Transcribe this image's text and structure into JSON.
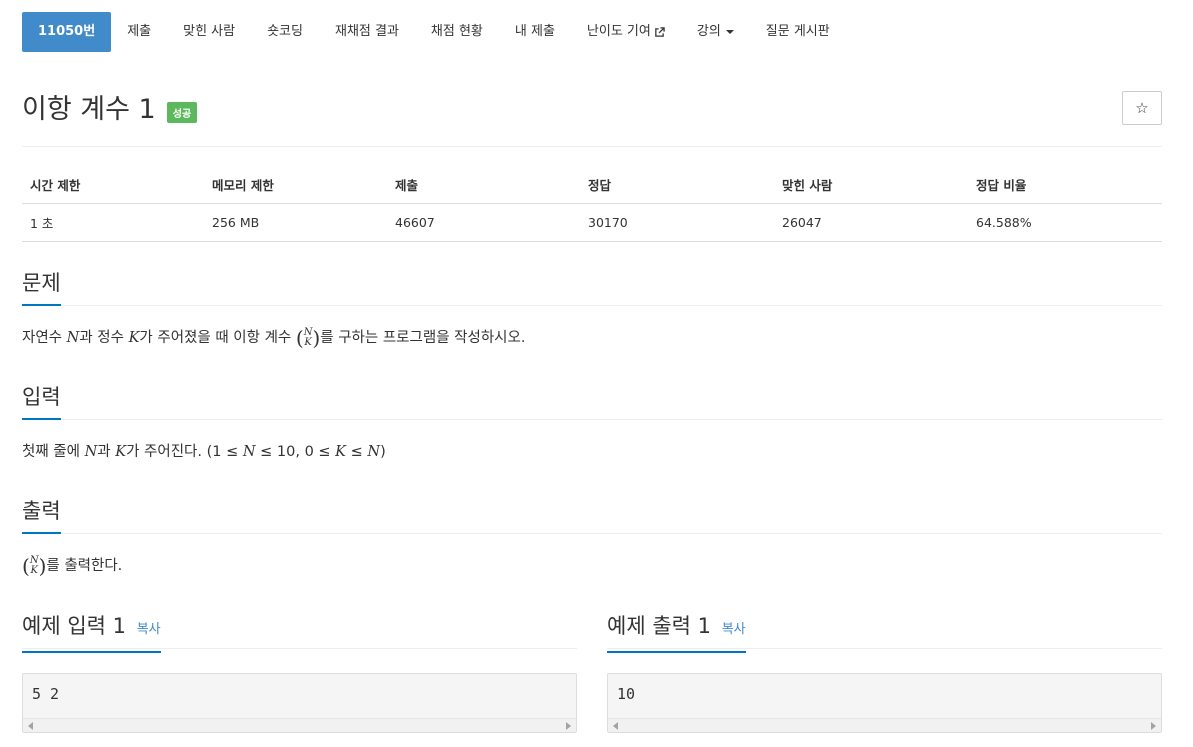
{
  "nav": {
    "items": [
      {
        "label": "11050번",
        "active": true
      },
      {
        "label": "제출"
      },
      {
        "label": "맞힌 사람"
      },
      {
        "label": "숏코딩"
      },
      {
        "label": "재채점 결과"
      },
      {
        "label": "채점 현황"
      },
      {
        "label": "내 제출"
      },
      {
        "label": "난이도 기여",
        "icon": "external-link-icon"
      },
      {
        "label": "강의",
        "icon": "caret-down-icon"
      },
      {
        "label": "질문 게시판"
      }
    ]
  },
  "problem": {
    "title": "이항 계수 1",
    "status_badge": "성공",
    "favorite_icon": "star-outline-icon"
  },
  "info_table": {
    "headers": [
      "시간 제한",
      "메모리 제한",
      "제출",
      "정답",
      "맞힌 사람",
      "정답 비율"
    ],
    "values": [
      "1 초",
      "256 MB",
      "46607",
      "30170",
      "26047",
      "64.588%"
    ]
  },
  "sections": {
    "problem": {
      "title": "문제",
      "text_1": "자연수 ",
      "var_n": "N",
      "text_2": "과 정수 ",
      "var_k": "K",
      "text_3": "가 주어졌을 때 이항 계수 ",
      "text_4": "를 구하는 프로그램을 작성하시오."
    },
    "input": {
      "title": "입력",
      "text_1": "첫째 줄에 ",
      "var_n": "N",
      "text_2": "과 ",
      "var_k": "K",
      "text_3": "가 주어진다. (1 ≤ ",
      "var_n2": "N",
      "text_4": " ≤ 10, 0 ≤ ",
      "var_k2": "K",
      "text_5": " ≤ ",
      "var_n3": "N",
      "text_6": ")"
    },
    "output": {
      "title": "출력",
      "text_1": "를 출력한다."
    }
  },
  "binomial": {
    "top": "N",
    "bottom": "K"
  },
  "samples": {
    "input": {
      "title": "예제 입력 1",
      "copy_label": "복사",
      "content": "5 2"
    },
    "output": {
      "title": "예제 출력 1",
      "copy_label": "복사",
      "content": "10"
    }
  },
  "colors": {
    "active_tab": "#428bca",
    "success_badge": "#5cb85c",
    "section_underline": "#0076c0",
    "link": "#428bca"
  }
}
